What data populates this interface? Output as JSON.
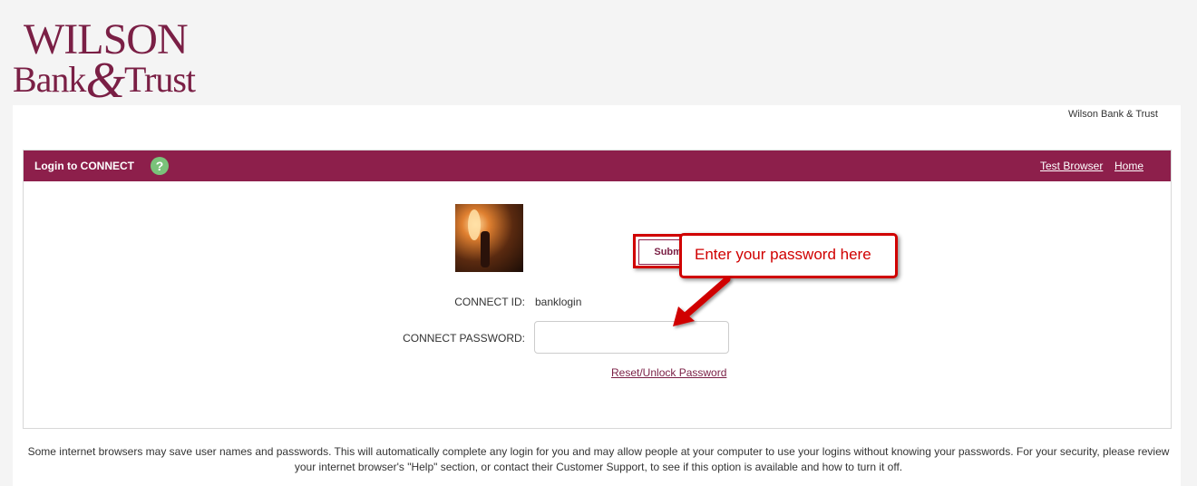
{
  "brand": {
    "line1": "WILSON",
    "line2_a": "Bank",
    "line2_amp": "&",
    "line2_b": "Trust"
  },
  "header_right": "Wilson Bank & Trust",
  "login": {
    "title": "Login to CONNECT",
    "help_icon": "?",
    "links": {
      "test_browser": "Test Browser",
      "home": "Home"
    },
    "connect_id_label": "CONNECT ID:",
    "connect_id_value": "banklogin",
    "password_label": "CONNECT PASSWORD:",
    "password_value": "",
    "reset_link": "Reset/Unlock Password",
    "submit_label": "Submit"
  },
  "annotation": {
    "callout_text": "Enter your password here",
    "color": "#d00000"
  },
  "footer": {
    "text": "Some internet browsers may save user names and passwords. This will automatically complete any login for you and may allow people at your computer to use your logins without knowing your passwords. For your security, please review your internet browser's \"Help\" section, or contact their Customer Support, to see if this option is available and how to turn it off."
  },
  "colors": {
    "accent": "#8d1f4b",
    "help_green": "#7ac27a"
  }
}
